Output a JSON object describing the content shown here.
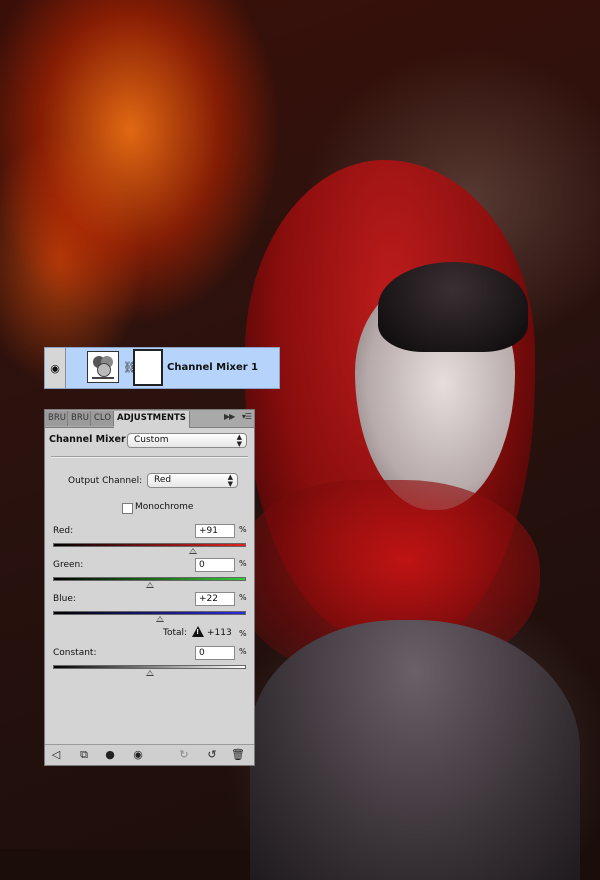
{
  "layer": {
    "name": "Channel Mixer 1",
    "visibility_icon": "eye-icon",
    "adjustment_icon": "channel-mixer-icon",
    "link_icon": "chain-link-icon"
  },
  "panel": {
    "tabs": [
      "BRU",
      "BRU",
      "CLO",
      "ADJUSTMENTS"
    ],
    "active_tab": "ADJUSTMENTS",
    "menu_icons": [
      "double-arrow-icon",
      "panel-menu-icon"
    ],
    "title": "Channel Mixer",
    "preset": "Custom",
    "output_channel_label": "Output Channel:",
    "output_channel": "Red",
    "monochrome_label": "Monochrome",
    "monochrome_checked": false,
    "sliders": [
      {
        "label": "Red:",
        "value": "+91",
        "level": 91,
        "unit": "%"
      },
      {
        "label": "Green:",
        "value": "0",
        "level": 0,
        "unit": "%"
      },
      {
        "label": "Blue:",
        "value": "+22",
        "level": 22,
        "unit": "%"
      }
    ],
    "total_label": "Total:",
    "total_value": "+113",
    "total_unit": "%",
    "constant": {
      "label": "Constant:",
      "value": "0",
      "level": 0,
      "unit": "%"
    },
    "footer_icons": [
      "back-arrow-icon",
      "expand-view-icon",
      "clip-layer-icon",
      "visibility-eye-icon",
      "previous-state-icon",
      "reset-icon",
      "trash-icon"
    ]
  },
  "colors": {
    "layer_selected": "#b6d4fb",
    "panel_bg": "#d4d4d4",
    "red_gradient_end": "#e32222",
    "green_gradient_end": "#33cc33",
    "blue_gradient_end": "#2a2ae0"
  }
}
